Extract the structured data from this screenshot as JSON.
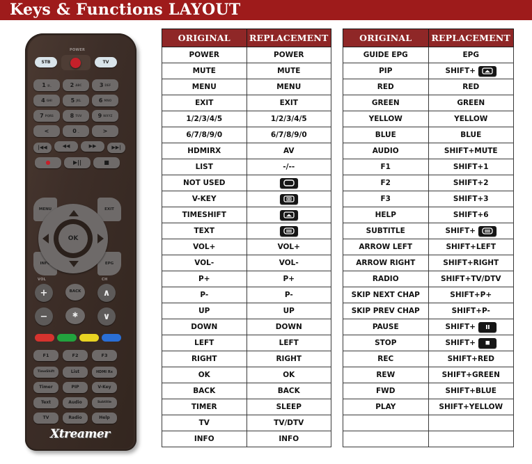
{
  "header": {
    "title": "Keys & Functions LAYOUT",
    "bar_color": "#9e1b1b"
  },
  "remote": {
    "brand": "Xtreamer",
    "power_label": "POWER",
    "top_buttons": [
      "STB",
      "TV"
    ],
    "keypad": [
      {
        "digit": "1",
        "sub": "@_"
      },
      {
        "digit": "2",
        "sub": "ABC"
      },
      {
        "digit": "3",
        "sub": "DEF"
      },
      {
        "digit": "4",
        "sub": "GHI"
      },
      {
        "digit": "5",
        "sub": "JKL"
      },
      {
        "digit": "6",
        "sub": "MNO"
      },
      {
        "digit": "7",
        "sub": "PQRS"
      },
      {
        "digit": "8",
        "sub": "TUV"
      },
      {
        "digit": "9",
        "sub": "WXYZ"
      },
      {
        "digit": "<",
        "sub": ""
      },
      {
        "digit": "0",
        "sub": "_"
      },
      {
        "digit": ">",
        "sub": ""
      }
    ],
    "transport_row1": [
      "|◀◀",
      "◀◀",
      "▶▶",
      "▶▶|"
    ],
    "transport_row2": [
      "●",
      "▶||",
      "■"
    ],
    "corner_keys": {
      "menu": "MENU",
      "exit": "EXIT",
      "info": "INFO",
      "epg": "EPG"
    },
    "dpad_ok": "OK",
    "vol_label": "VOL",
    "ch_label": "CH",
    "vol_up": "+",
    "vol_down": "−",
    "ch_up": "∧",
    "ch_down": "∨",
    "back": "BACK",
    "mute": "✱",
    "color_keys": [
      {
        "name": "red",
        "color": "#d6332e"
      },
      {
        "name": "green",
        "color": "#22a33e"
      },
      {
        "name": "yellow",
        "color": "#e8d322"
      },
      {
        "name": "blue",
        "color": "#2a6fd6"
      }
    ],
    "function_keys": [
      "F1",
      "F2",
      "F3"
    ],
    "grid_keys": [
      "TimeShift",
      "List",
      "HDMI Rx",
      "Timer",
      "PIP",
      "V-Key",
      "Text",
      "Audio",
      "Subtitle",
      "TV",
      "Radio",
      "Help"
    ]
  },
  "tables": {
    "headers": {
      "original": "ORIGINAL",
      "replacement": "REPLACEMENT"
    },
    "left_rows": [
      {
        "original": "POWER",
        "replacement": "POWER"
      },
      {
        "original": "MUTE",
        "replacement": "MUTE"
      },
      {
        "original": "MENU",
        "replacement": "MENU"
      },
      {
        "original": "EXIT",
        "replacement": "EXIT"
      },
      {
        "original": "1/2/3/4/5",
        "replacement": "1/2/3/4/5"
      },
      {
        "original": "6/7/8/9/0",
        "replacement": "6/7/8/9/0"
      },
      {
        "original": "HDMIRX",
        "replacement": "AV"
      },
      {
        "original": "LIST",
        "replacement": "-/--"
      },
      {
        "original": "NOT USED",
        "replacement": "",
        "icon": "screen-blank-icon"
      },
      {
        "original": "V-KEY",
        "replacement": "",
        "icon": "screen-plus-icon"
      },
      {
        "original": "TIMESHIFT",
        "replacement": "",
        "icon": "screen-timeshift-icon"
      },
      {
        "original": "TEXT",
        "replacement": "",
        "icon": "screen-text-icon"
      },
      {
        "original": "VOL+",
        "replacement": "VOL+"
      },
      {
        "original": "VOL-",
        "replacement": "VOL-"
      },
      {
        "original": "P+",
        "replacement": "P+"
      },
      {
        "original": "P-",
        "replacement": "P-"
      },
      {
        "original": "UP",
        "replacement": "UP"
      },
      {
        "original": "DOWN",
        "replacement": "DOWN"
      },
      {
        "original": "LEFT",
        "replacement": "LEFT"
      },
      {
        "original": "RIGHT",
        "replacement": "RIGHT"
      },
      {
        "original": "OK",
        "replacement": "OK"
      },
      {
        "original": "BACK",
        "replacement": "BACK"
      },
      {
        "original": "TIMER",
        "replacement": "SLEEP"
      },
      {
        "original": "TV",
        "replacement": "TV/DTV"
      },
      {
        "original": "INFO",
        "replacement": "INFO"
      }
    ],
    "right_rows": [
      {
        "original": "GUIDE EPG",
        "replacement": "EPG"
      },
      {
        "original": "PIP",
        "replacement": "SHIFT+",
        "icon": "screen-timeshift-icon"
      },
      {
        "original": "RED",
        "replacement": "RED"
      },
      {
        "original": "GREEN",
        "replacement": "GREEN"
      },
      {
        "original": "YELLOW",
        "replacement": "YELLOW"
      },
      {
        "original": "BLUE",
        "replacement": "BLUE"
      },
      {
        "original": "AUDIO",
        "replacement": "SHIFT+MUTE"
      },
      {
        "original": "F1",
        "replacement": "SHIFT+1"
      },
      {
        "original": "F2",
        "replacement": "SHIFT+2"
      },
      {
        "original": "F3",
        "replacement": "SHIFT+3"
      },
      {
        "original": "HELP",
        "replacement": "SHIFT+6"
      },
      {
        "original": "SUBTITLE",
        "replacement": "SHIFT+",
        "icon": "screen-text-icon"
      },
      {
        "original": "ARROW LEFT",
        "replacement": "SHIFT+LEFT"
      },
      {
        "original": "ARROW RIGHT",
        "replacement": "SHIFT+RIGHT"
      },
      {
        "original": "RADIO",
        "replacement": "SHIFT+TV/DTV"
      },
      {
        "original": "SKIP NEXT CHAP",
        "replacement": "SHIFT+P+"
      },
      {
        "original": "SKIP PREV CHAP",
        "replacement": "SHIFT+P-"
      },
      {
        "original": "PAUSE",
        "replacement": "SHIFT+",
        "icon": "pause-icon"
      },
      {
        "original": "STOP",
        "replacement": "SHIFT+",
        "icon": "stop-icon"
      },
      {
        "original": "REC",
        "replacement": "SHIFT+RED"
      },
      {
        "original": "REW",
        "replacement": "SHIFT+GREEN"
      },
      {
        "original": "FWD",
        "replacement": "SHIFT+BLUE"
      },
      {
        "original": "PLAY",
        "replacement": "SHIFT+YELLOW"
      },
      {
        "original": "",
        "replacement": ""
      },
      {
        "original": "",
        "replacement": ""
      }
    ]
  }
}
